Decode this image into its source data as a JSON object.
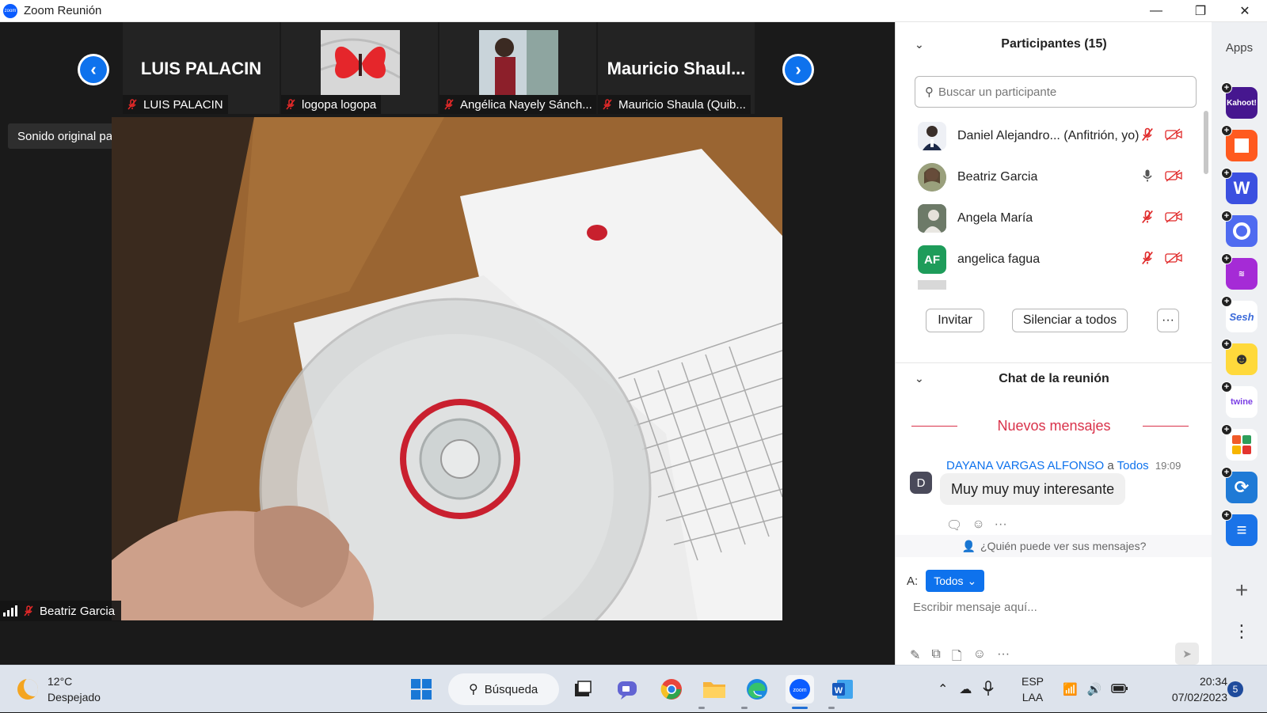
{
  "window": {
    "title": "Zoom Reunión",
    "min": "—",
    "restore": "❐",
    "close": "✕"
  },
  "strip": {
    "tiles": [
      {
        "big_name": "LUIS PALACIN",
        "label": "LUIS PALACIN"
      },
      {
        "big_name": "",
        "label": "logopa logopa"
      },
      {
        "big_name": "",
        "label": "Angélica Nayely Sánch..."
      },
      {
        "big_name": "Mauricio  Shaul...",
        "label": "Mauricio Shaula (Quib..."
      }
    ],
    "prev_glyph": "‹",
    "next_glyph": "›"
  },
  "sound_tip": "Sonido original para músicos: desactivado",
  "video_label": "Beatriz Garcia",
  "participants": {
    "title": "Participantes (15)",
    "search_placeholder": "Buscar un participante",
    "list": [
      {
        "name": "Daniel Alejandro...  (Anfitrión, yo)",
        "avatar_color": "#ffffff",
        "avatar_text": "",
        "mic": "off"
      },
      {
        "name": "Beatriz Garcia",
        "avatar_color": "#7a8a6a",
        "avatar_text": "",
        "mic": "on"
      },
      {
        "name": "Angela María",
        "avatar_color": "#3d4a3c",
        "avatar_text": "",
        "mic": "off"
      },
      {
        "name": "angelica fagua",
        "avatar_color": "#1e9c5a",
        "avatar_text": "AF",
        "mic": "off"
      }
    ],
    "invite": "Invitar",
    "mute_all": "Silenciar a todos",
    "more": "···"
  },
  "chat": {
    "title": "Chat de la reunión",
    "new_messages": "Nuevos mensajes",
    "message": {
      "sender": "DAYANA VARGAS ALFONSO",
      "to_word": "a",
      "to": "Todos",
      "time": "19:09",
      "avatar": "D",
      "text": "Muy muy muy interesante"
    },
    "who_can_see": "¿Quién puede ver sus mensajes?",
    "to_label": "A:",
    "to_value": "Todos",
    "compose_placeholder": "Escribir mensaje aquí..."
  },
  "apps": {
    "title": "Apps",
    "tiles": [
      {
        "name": "kahoot",
        "label": "Kahoot!",
        "color": "#46178f"
      },
      {
        "name": "app-orange",
        "label": "",
        "color": "#ff5a1f"
      },
      {
        "name": "wooclap",
        "label": "W",
        "color": "#3b50e0"
      },
      {
        "name": "app-circle",
        "label": "",
        "color": "#4f6bf0"
      },
      {
        "name": "app-purple",
        "label": "",
        "color": "#a52bd6"
      },
      {
        "name": "sesh",
        "label": "Sesh",
        "color": "#ffffff"
      },
      {
        "name": "app-smile",
        "label": "",
        "color": "#ffd93b"
      },
      {
        "name": "twine",
        "label": "twine",
        "color": "#ffffff"
      },
      {
        "name": "app-blocks",
        "label": "",
        "color": "#ffffff"
      },
      {
        "name": "app-sync",
        "label": "",
        "color": "#1f7ad6"
      },
      {
        "name": "app-e",
        "label": "",
        "color": "#1a73e8"
      }
    ],
    "add": "+",
    "more": "⋮"
  },
  "taskbar": {
    "temp": "12°C",
    "weather": "Despejado",
    "search": "Búsqueda",
    "lang1": "ESP",
    "lang2": "LAA",
    "time": "20:34",
    "date": "07/02/2023",
    "notifications": "5"
  }
}
